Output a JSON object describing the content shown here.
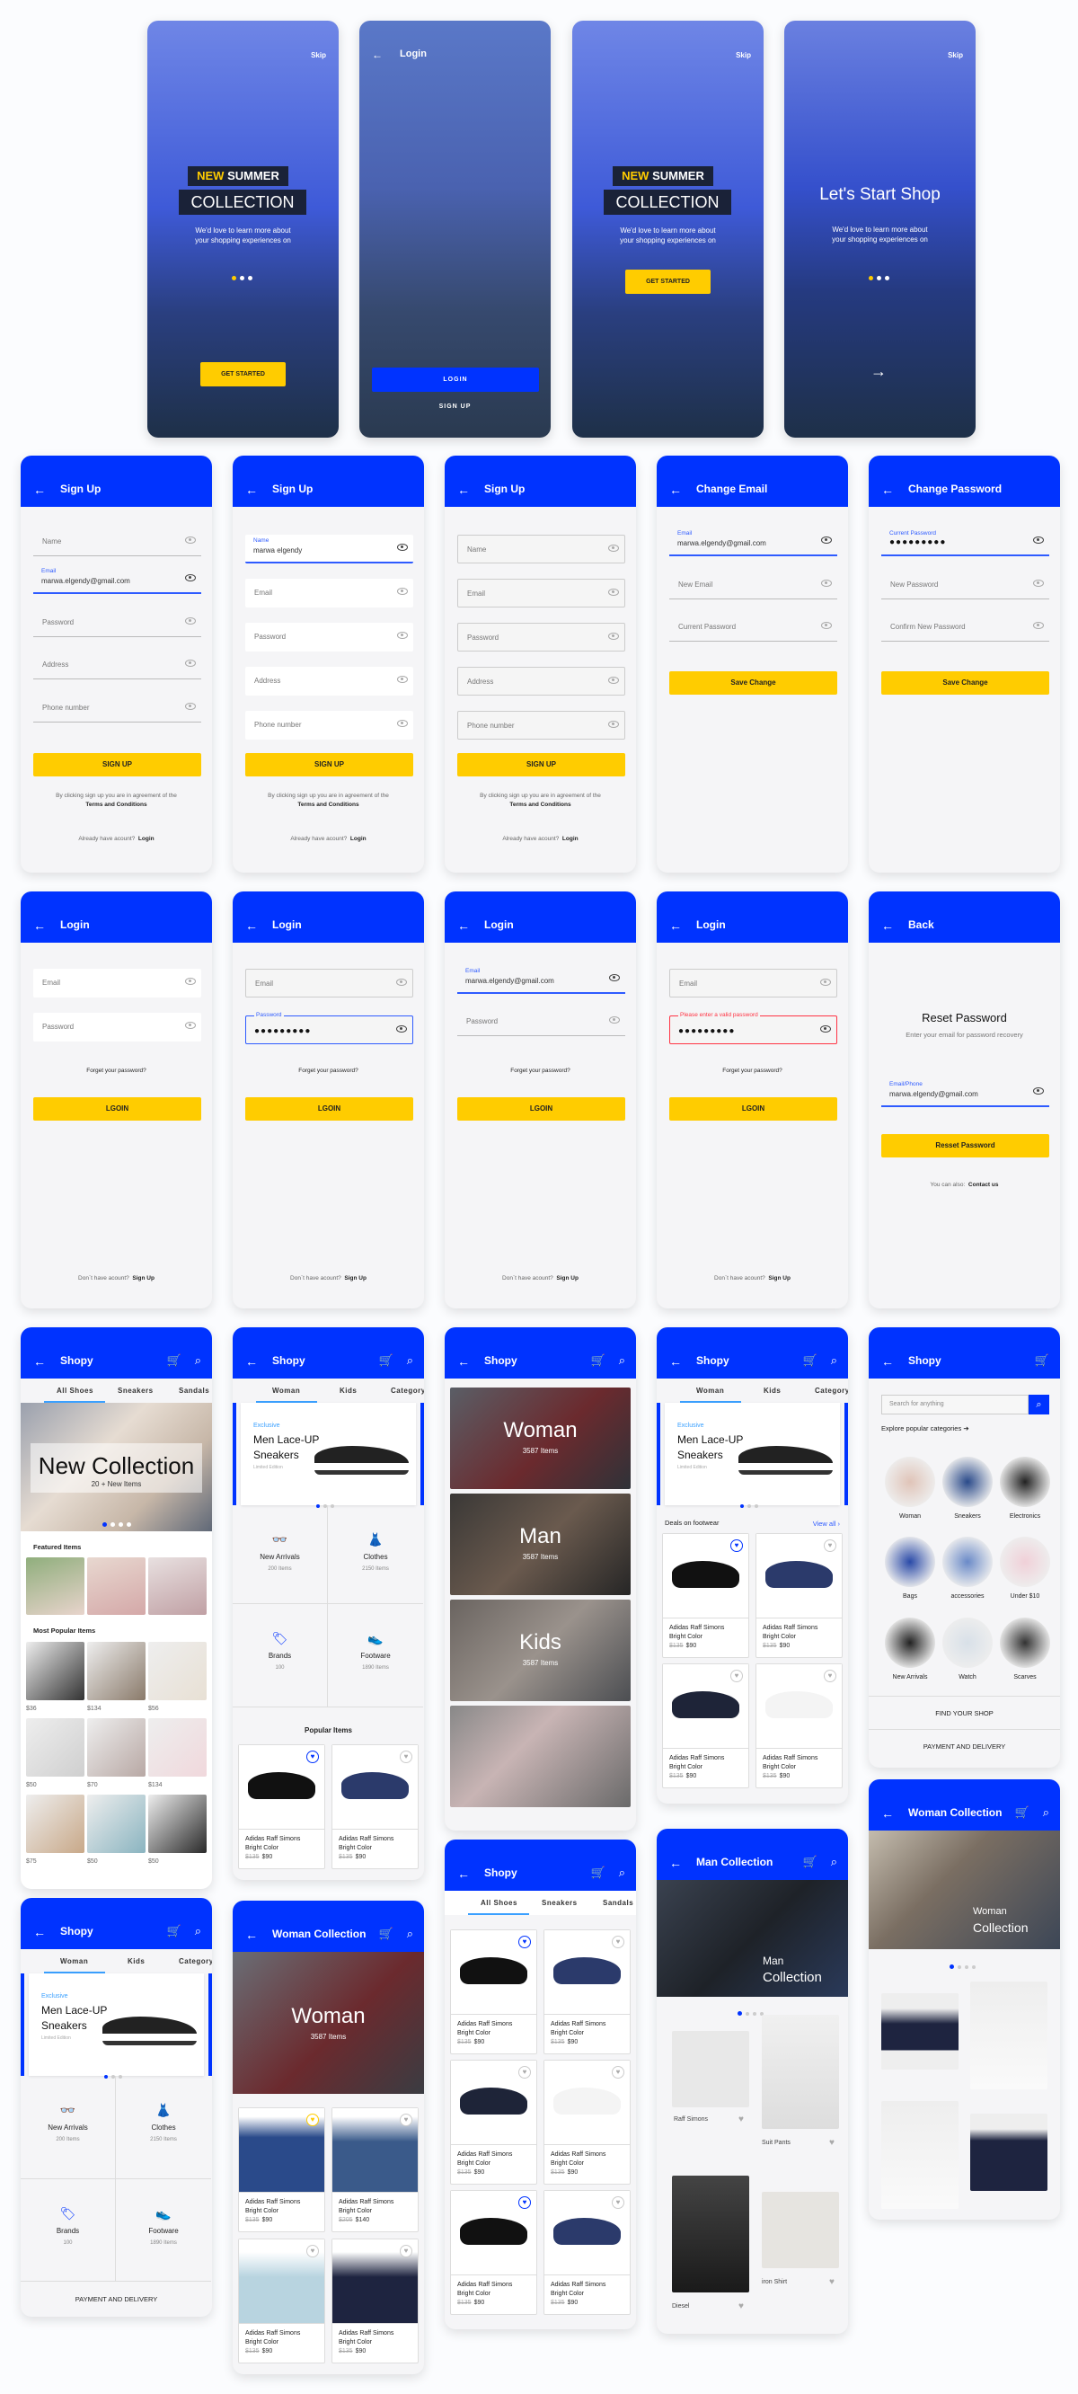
{
  "brand": {
    "primary": "#0033ff",
    "accent": "#ffcc00",
    "error": "#ff3344"
  },
  "icons": {
    "back": "←",
    "forward": "→",
    "cart": "🛒",
    "search": "⌕",
    "heart": "♥",
    "chevron": "›",
    "arrow_right": "➔",
    "glasses": "👓",
    "dress": "👗",
    "tag": "🏷",
    "shoe": "👟"
  },
  "onboarding": [
    {
      "skip": "Skip",
      "headline_new": "NEW",
      "headline_summer": "SUMMER",
      "headline_collection": "COLLECTION",
      "body": "We'd love to learn more about your shopping experiences on",
      "cta": "GET STARTED"
    },
    {
      "title": "Login",
      "login": "LOGIN",
      "signup": "SIGN UP"
    },
    {
      "skip": "Skip",
      "headline_new": "NEW",
      "headline_summer": "SUMMER",
      "headline_collection": "COLLECTION",
      "body": "We'd love to learn more about your shopping experiences on",
      "cta": "GET STARTED"
    },
    {
      "skip": "Skip",
      "headline": "Let's Start Shop",
      "body": "We'd love to learn more about your shopping experiences on"
    }
  ],
  "signup": {
    "title": "Sign Up",
    "fields": {
      "name": "Name",
      "email": "Email",
      "password": "Password",
      "address": "Address",
      "phone": "Phone number"
    },
    "email_value": "marwa.elgendy@gmail.com",
    "name_value": "marwa elgendy",
    "button": "SIGN UP",
    "terms_text": "By clicking sign up you are in agreement of the",
    "terms_link": "Terms and Conditions",
    "have_account": "Already have acount?",
    "login_link": "Login"
  },
  "change_email": {
    "title": "Change Email",
    "email_label": "Email",
    "email_value": "marwa.elgendy@gmail.com",
    "new_email": "New Email",
    "current_password": "Current Password",
    "button": "Save Change"
  },
  "change_password": {
    "title": "Change Password",
    "current_label": "Current Password",
    "current_value": "●●●●●●●●●",
    "new_password": "New Password",
    "confirm": "Confirm New Password",
    "button": "Save Change"
  },
  "login": {
    "title": "Login",
    "email": "Email",
    "password": "Password",
    "password_value": "●●●●●●●●●",
    "email_value": "marwa.elgendy@gmail.com",
    "error": "Please enter a valid password",
    "forgot": "Forget your password?",
    "button": "LGOIN",
    "no_account": "Don`t have acount?",
    "signup_link": "Sign Up"
  },
  "reset": {
    "title": "Back",
    "heading": "Reset Password",
    "sub": "Enter your email for password recovery",
    "field_label": "Email/Phone",
    "field_value": "marwa.elgendy@gmail.com",
    "button": "Resset Password",
    "also": "You can also:",
    "contact": "Contact us"
  },
  "shop": {
    "title": "Shopy",
    "tabs_shoes": [
      "All Shoes",
      "Sneakers",
      "Sandals"
    ],
    "tabs_woman": [
      "Woman",
      "Kids",
      "Category"
    ],
    "new_collection": "New Collection",
    "new_items": "20 + New Items",
    "featured": "Featured Items",
    "most_popular": "Most Popular Items",
    "popular_prices": [
      "$36",
      "$134",
      "$56",
      "$50",
      "$70",
      "$134",
      "$75",
      "$50",
      "$50"
    ],
    "banner": {
      "tag": "Exclusive",
      "title1": "Men Lace-UP",
      "title2": "Sneakers",
      "sub": "Limited Edition"
    },
    "categories": [
      {
        "title": "New Arrivals",
        "count": "200 Items"
      },
      {
        "title": "Clothes",
        "count": "2150 Items"
      },
      {
        "title": "Brands",
        "count": "100"
      },
      {
        "title": "Footware",
        "count": "1890 Items"
      }
    ],
    "popular_items": "Popular Items",
    "deals": "Deals on footwear",
    "view_all": "View all",
    "product": {
      "name1": "Adidas Raff Simons",
      "name2": "Bright Color",
      "old": "$135",
      "price": "$90"
    },
    "product_alt": {
      "old": "$205",
      "price": "$140"
    },
    "collections": [
      {
        "title": "Woman",
        "count": "3587 Items"
      },
      {
        "title": "Man",
        "count": "3587 Items"
      },
      {
        "title": "Kids",
        "count": "3587 Items"
      }
    ],
    "payment": "PAYMENT AND DELIVERY",
    "find_shop": "FIND YOUR SHOP",
    "search_placeholder": "Search for anything",
    "explore": "Explore popular categories",
    "explore_cats": [
      "Woman",
      "Sneakers",
      "Electronics",
      "Bags",
      "accessories",
      "Under $10",
      "New Arrivals",
      "Watch",
      "Scarves"
    ]
  },
  "woman_collection": {
    "title": "Woman Collection",
    "hero": "Woman",
    "count": "3587 Items",
    "hero2_l1": "Woman",
    "hero2_l2": "Collection"
  },
  "man_collection": {
    "title": "Man Collection",
    "hero_l1": "Man",
    "hero_l2": "Collection",
    "items": [
      "Raff Simons",
      "Suit Pants",
      "Diesel",
      "iron Shirt"
    ]
  }
}
